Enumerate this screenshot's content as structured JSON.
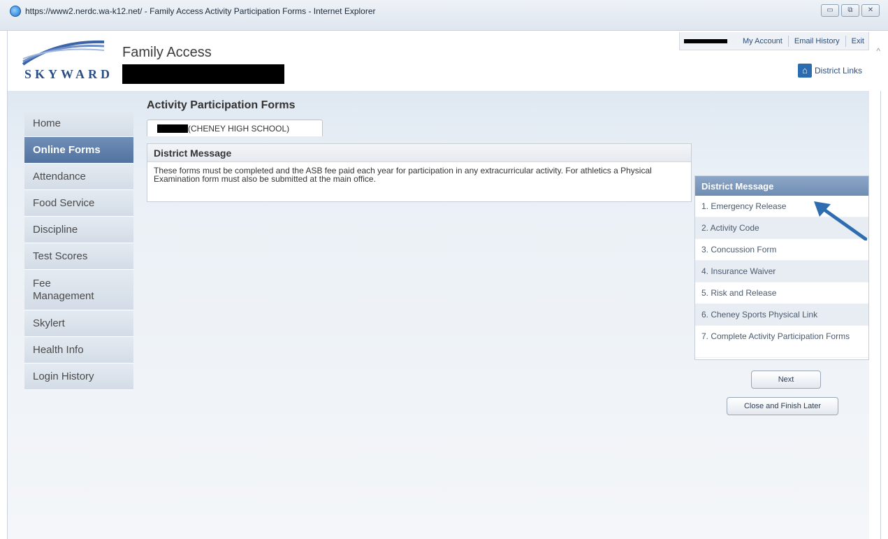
{
  "window": {
    "title": "https://www2.nerdc.wa-k12.net/ - Family Access Activity Participation Forms - Internet Explorer",
    "buttons": [
      "▭",
      "⧉",
      "✕"
    ]
  },
  "header": {
    "logo_text": "SKYWARD",
    "app_title": "Family Access",
    "top_links": [
      "My Account",
      "Email History",
      "Exit"
    ],
    "district_links": "District Links"
  },
  "sidebar": {
    "items": [
      {
        "label": "Home"
      },
      {
        "label": "Online Forms"
      },
      {
        "label": "Attendance"
      },
      {
        "label": "Food Service"
      },
      {
        "label": "Discipline"
      },
      {
        "label": "Test Scores"
      },
      {
        "label": "Fee Management"
      },
      {
        "label": "Skylert"
      },
      {
        "label": "Health Info"
      },
      {
        "label": "Login History"
      }
    ]
  },
  "main": {
    "page_title": "Activity Participation Forms",
    "student_tab": "(CHENEY HIGH SCHOOL)",
    "content_title": "District Message",
    "content_text": "These forms must be completed and the ASB fee paid each year for participation in any extracurricular activity. For athletics a Physical Examination form must also be submitted at the main office."
  },
  "steps": {
    "header": "District Message",
    "items": [
      "1. Emergency Release",
      "2. Activity Code",
      "3. Concussion Form",
      "4. Insurance Waiver",
      "5. Risk and Release",
      "6. Cheney Sports Physical Link",
      "7. Complete Activity Participation Forms"
    ]
  },
  "buttons": {
    "next": "Next",
    "close": "Close and Finish Later"
  },
  "colors": {
    "accent": "#52739f",
    "arrow": "#2e6db0"
  }
}
